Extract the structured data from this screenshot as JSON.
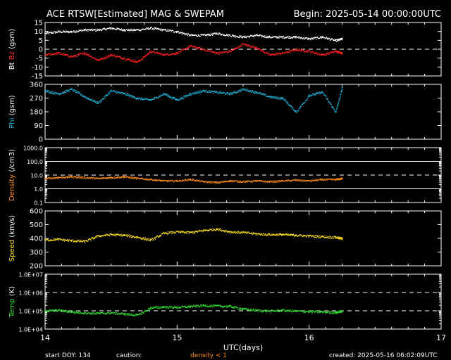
{
  "header": {
    "title": "ACE RTSW[Estimated] MAG & SWEPAM",
    "begin": "Begin: 2025-05-14 00:00:00UTC"
  },
  "footer": {
    "start_doy": "start DOY: 134",
    "caution": "caution:",
    "density_note": "density < 1",
    "created": "created: 2025-05-16 06:02:09UTC"
  },
  "colors": {
    "background": "#000000",
    "axes": "#ffffff",
    "bt": "#ffffff",
    "bz": "#ff2020",
    "phi": "#20b8e0",
    "density": "#ff8c1a",
    "speed": "#ffe020",
    "temp": "#30e030",
    "caution": "#ff8c1a"
  },
  "chart_data": {
    "type": "scatter",
    "x_axis": {
      "label": "UTC(days)",
      "range": [
        14,
        17
      ],
      "ticks": [
        "14",
        "15",
        "16",
        "17"
      ],
      "data_end": 16.25
    },
    "panels": [
      {
        "id": "mag",
        "ylabel": {
          "bt": "Bt",
          "bz": "Bz",
          "unit": "(gsm)"
        },
        "scale": "linear",
        "ylim": [
          -15,
          15
        ],
        "ticks": [
          "15",
          "10",
          "5",
          "0",
          "-5",
          "-10",
          "-15"
        ],
        "tick_values": [
          15,
          10,
          5,
          0,
          -5,
          -10,
          -15
        ],
        "dashed_lines": [
          0
        ],
        "series": [
          {
            "name": "Bt",
            "x": [
              14.0,
              14.1,
              14.2,
              14.3,
              14.4,
              14.5,
              14.6,
              14.7,
              14.8,
              14.9,
              15.0,
              15.1,
              15.2,
              15.3,
              15.4,
              15.5,
              15.6,
              15.7,
              15.8,
              15.9,
              16.0,
              16.1,
              16.2,
              16.25
            ],
            "y": [
              9,
              10,
              10,
              11,
              11,
              12,
              11,
              11,
              12,
              11,
              10,
              8,
              8,
              9,
              8,
              7,
              8,
              7,
              7,
              7,
              6,
              7,
              5,
              6
            ]
          },
          {
            "name": "Bz",
            "x": [
              14.0,
              14.1,
              14.2,
              14.3,
              14.4,
              14.5,
              14.6,
              14.7,
              14.8,
              14.9,
              15.0,
              15.1,
              15.2,
              15.3,
              15.4,
              15.5,
              15.6,
              15.7,
              15.8,
              15.9,
              16.0,
              16.1,
              16.2,
              16.25
            ],
            "y": [
              -3,
              -2,
              -4,
              -2,
              -6,
              -3,
              -5,
              -7,
              -1,
              -3,
              -2,
              2,
              0,
              -2,
              -1,
              3,
              1,
              -3,
              -2,
              0,
              -1,
              -3,
              -1,
              -2
            ]
          }
        ]
      },
      {
        "id": "phi",
        "ylabel": {
          "name": "Phi",
          "unit": "(gsm)"
        },
        "scale": "linear",
        "ylim": [
          0,
          360
        ],
        "ticks": [
          "360",
          "270",
          "180",
          "90",
          "0"
        ],
        "tick_values": [
          360,
          270,
          180,
          90,
          0
        ],
        "series": [
          {
            "name": "Phi",
            "x": [
              14.0,
              14.1,
              14.2,
              14.3,
              14.4,
              14.5,
              14.6,
              14.7,
              14.8,
              14.9,
              15.0,
              15.1,
              15.2,
              15.3,
              15.4,
              15.5,
              15.6,
              15.7,
              15.8,
              15.9,
              16.0,
              16.1,
              16.2,
              16.25
            ],
            "y": [
              320,
              300,
              330,
              280,
              240,
              320,
              300,
              270,
              260,
              300,
              260,
              300,
              320,
              310,
              300,
              330,
              310,
              280,
              270,
              180,
              290,
              310,
              180,
              340
            ]
          }
        ]
      },
      {
        "id": "density",
        "ylabel": {
          "name": "Density",
          "unit": "(/cm3)"
        },
        "scale": "log",
        "ylim": [
          0.1,
          1000
        ],
        "ticks": [
          "1000.0",
          "100.0",
          "10.0",
          "1.0",
          "0.1"
        ],
        "tick_values": [
          1000,
          100,
          10,
          1,
          0.1
        ],
        "solid_lines": [
          100,
          1
        ],
        "dashed_lines": [
          10
        ],
        "series": [
          {
            "name": "Density",
            "x": [
              14.0,
              14.1,
              14.2,
              14.3,
              14.4,
              14.5,
              14.6,
              14.7,
              14.8,
              14.9,
              15.0,
              15.1,
              15.2,
              15.3,
              15.4,
              15.5,
              15.6,
              15.7,
              15.8,
              15.9,
              16.0,
              16.1,
              16.2,
              16.25
            ],
            "y": [
              6,
              7,
              8,
              7,
              6,
              7,
              8,
              6,
              5,
              4,
              4,
              5,
              3.5,
              3,
              4,
              3.5,
              4,
              3.5,
              4,
              4.5,
              4,
              5,
              5,
              6
            ]
          }
        ]
      },
      {
        "id": "speed",
        "ylabel": {
          "name": "Speed",
          "unit": "(km/s)"
        },
        "scale": "linear",
        "ylim": [
          200,
          600
        ],
        "ticks": [
          "600",
          "500",
          "400",
          "300",
          "200"
        ],
        "tick_values": [
          600,
          500,
          400,
          300,
          200
        ],
        "series": [
          {
            "name": "Speed",
            "x": [
              14.0,
              14.1,
              14.2,
              14.3,
              14.4,
              14.5,
              14.6,
              14.7,
              14.8,
              14.9,
              15.0,
              15.1,
              15.2,
              15.3,
              15.4,
              15.5,
              15.6,
              15.7,
              15.8,
              15.9,
              16.0,
              16.1,
              16.2,
              16.25
            ],
            "y": [
              390,
              395,
              385,
              380,
              420,
              430,
              425,
              410,
              390,
              440,
              450,
              445,
              460,
              470,
              450,
              445,
              435,
              430,
              430,
              425,
              420,
              415,
              410,
              400
            ]
          }
        ]
      },
      {
        "id": "temp",
        "ylabel": {
          "name": "Temp",
          "unit": "(K)"
        },
        "scale": "log",
        "ylim": [
          10000,
          10000000
        ],
        "ticks": [
          "1.0E+07",
          "1.0E+06",
          "1.0E+05",
          "1.0E+04"
        ],
        "tick_values": [
          10000000,
          1000000,
          100000,
          10000
        ],
        "dashed_lines": [
          1000000,
          100000
        ],
        "series": [
          {
            "name": "Temp",
            "x": [
              14.0,
              14.1,
              14.2,
              14.3,
              14.4,
              14.5,
              14.6,
              14.7,
              14.8,
              14.9,
              15.0,
              15.1,
              15.2,
              15.3,
              15.4,
              15.5,
              15.6,
              15.7,
              15.8,
              15.9,
              16.0,
              16.1,
              16.2,
              16.25
            ],
            "y": [
              100000,
              110000,
              90000,
              80000,
              75000,
              80000,
              70000,
              60000,
              150000,
              170000,
              160000,
              180000,
              200000,
              190000,
              180000,
              130000,
              110000,
              100000,
              110000,
              100000,
              95000,
              90000,
              85000,
              100000
            ]
          }
        ]
      }
    ]
  }
}
